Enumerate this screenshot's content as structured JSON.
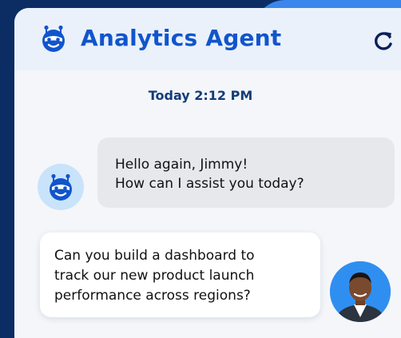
{
  "colors": {
    "page_background": "#0b2d63",
    "accent": "#1155cc",
    "header_background": "#eaf1fb",
    "bot_bubble": "#e6e8ec",
    "user_bubble": "#ffffff",
    "bot_avatar_background": "#c9e3fb"
  },
  "header": {
    "title": "Analytics Agent",
    "logo_icon": "robot-icon",
    "refresh_icon": "refresh-icon"
  },
  "chat": {
    "timestamp": "Today 2:12 PM",
    "messages": [
      {
        "sender": "agent",
        "avatar_icon": "robot-icon",
        "lines": [
          "Hello again, Jimmy!",
          "How can I assist you today?"
        ]
      },
      {
        "sender": "user",
        "avatar_icon": "user-photo",
        "lines": [
          "Can you build a dashboard to",
          "track our new product launch",
          "performance across regions?"
        ]
      }
    ]
  }
}
